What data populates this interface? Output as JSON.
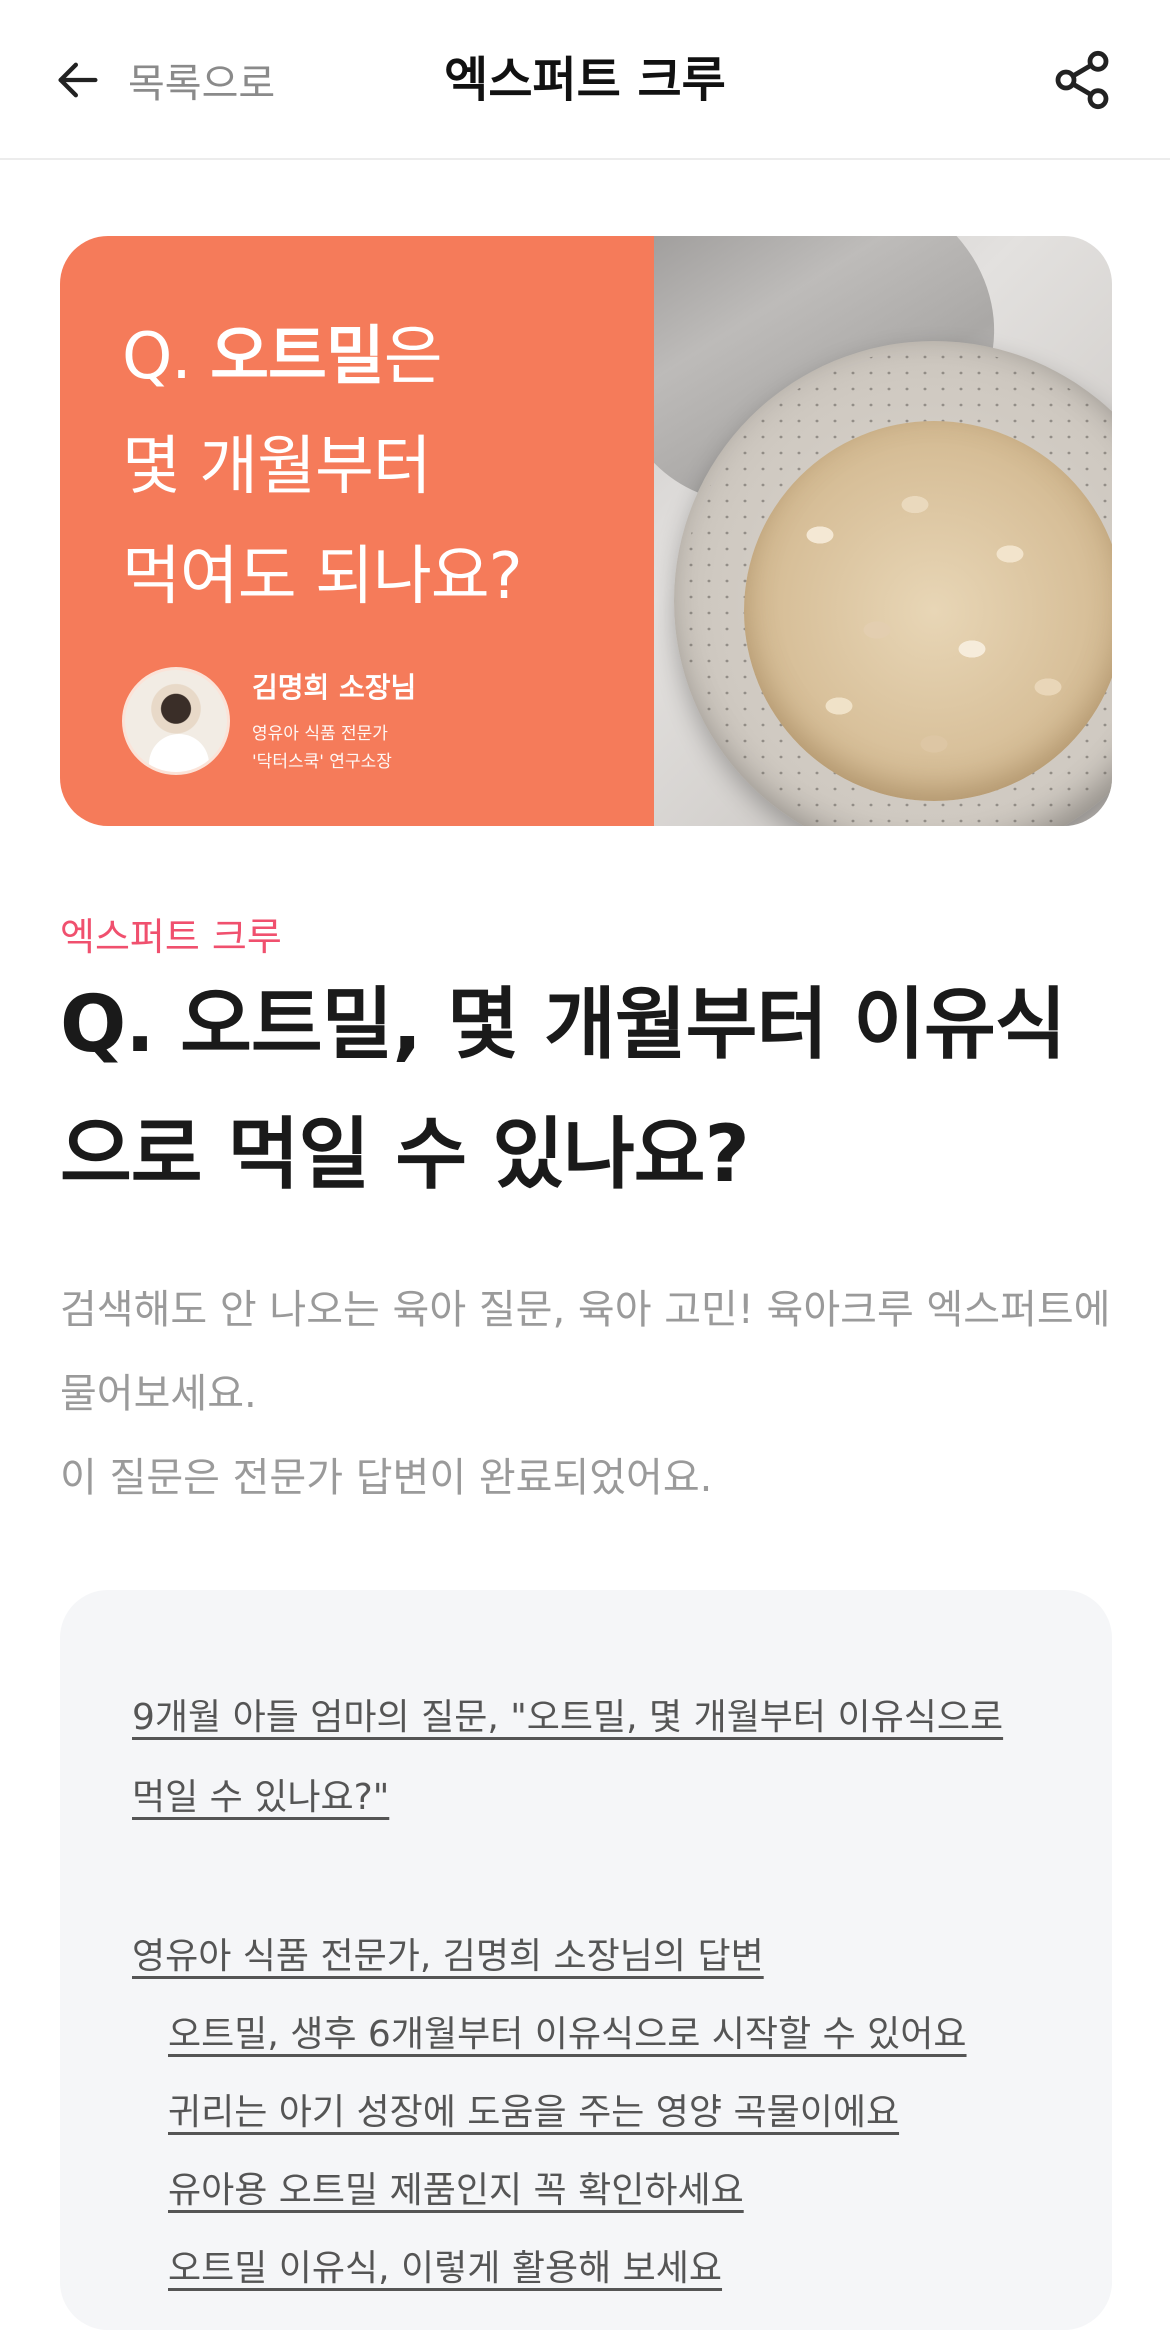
{
  "header": {
    "back_label": "목록으로",
    "title": "엑스퍼트 크루"
  },
  "banner": {
    "question_prefix": "Q. ",
    "question_highlight": "오트밀",
    "question_line1_suffix": "은",
    "question_line2": "몇 개월부터",
    "question_line3": "먹여도 되나요?",
    "expert_name": "김명희 소장님",
    "expert_desc_line1": "영유아 식품 전문가",
    "expert_desc_line2": "'닥터스쿡' 연구소장",
    "background_color": "#f57b5a"
  },
  "article": {
    "category": "엑스퍼트 크루",
    "category_color": "#f0506e",
    "title": "Q. 오트밀, 몇 개월부터 이유식으로 먹일 수 있나요?",
    "intro_line1": "검색해도 안 나오는 육아 질문, 육아 고민! 육아크루 엑스퍼트에 물어보세요.",
    "intro_line2": "이 질문은 전문가 답변이 완료되었어요."
  },
  "toc": {
    "question_link": "9개월 아들 엄마의 질문, \"오트밀, 몇 개월부터 이유식으로 먹일 수 있나요?\"",
    "answer_link": "영유아 식품 전문가, 김명희 소장님의 답변",
    "sub_links": [
      "오트밀, 생후 6개월부터 이유식으로 시작할 수 있어요",
      "귀리는 아기 성장에 도움을 주는 영양 곡물이에요",
      "유아용 오트밀 제품인지 꼭 확인하세요",
      "오트밀 이유식, 이렇게 활용해 보세요"
    ]
  },
  "icons": {
    "back": "arrow-left-icon",
    "share": "share-icon"
  }
}
